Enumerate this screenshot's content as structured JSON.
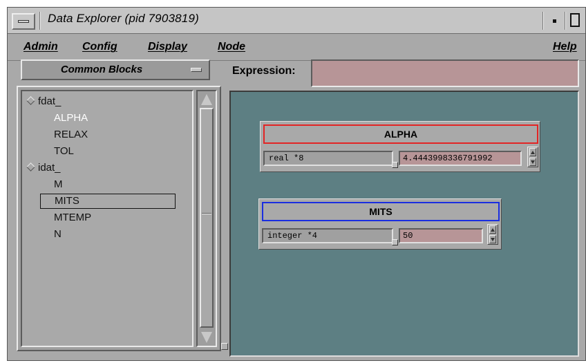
{
  "window": {
    "title": "Data Explorer (pid 7903819)",
    "icons": {
      "menu": "window-menu-icon",
      "minimize": "minimize-icon",
      "maximize": "maximize-icon"
    }
  },
  "menubar": {
    "items": [
      "Admin",
      "Config",
      "Display",
      "Node"
    ],
    "help": "Help"
  },
  "left_pane": {
    "selector_label": "Common Blocks",
    "tree": [
      {
        "label": "fdat_",
        "level": 1,
        "expandable": true
      },
      {
        "label": "ALPHA",
        "level": 2,
        "highlight": true
      },
      {
        "label": "RELAX",
        "level": 2
      },
      {
        "label": "TOL",
        "level": 2
      },
      {
        "label": "idat_",
        "level": 1,
        "expandable": true
      },
      {
        "label": "M",
        "level": 2
      },
      {
        "label": "MITS",
        "level": 2,
        "selected": true
      },
      {
        "label": "MTEMP",
        "level": 2
      },
      {
        "label": "N",
        "level": 2
      }
    ]
  },
  "expression": {
    "label": "Expression:",
    "value": ""
  },
  "variables": [
    {
      "name": "ALPHA",
      "type": "real *8",
      "value": "4.4443998336791992",
      "border_color": "#e32424"
    },
    {
      "name": "MITS",
      "type": "integer *4",
      "value": "50",
      "border_color": "#1a2ee0"
    }
  ],
  "colors": {
    "canvas_bg": "#5d7f83",
    "field_bg": "#b79597",
    "panel_bg": "#a9a9a9"
  }
}
